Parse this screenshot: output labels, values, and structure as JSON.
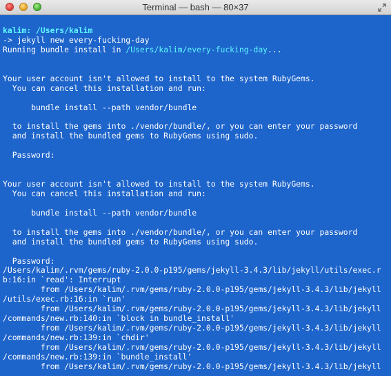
{
  "window": {
    "title": "Terminal — bash — 80×37"
  },
  "prompt": {
    "user": "kalim:",
    "path": "/Users/kalim"
  },
  "lines": [
    {
      "type": "cmd",
      "text": "-> jekyll new every-fucking-day"
    },
    {
      "type": "running",
      "prefix": "Running bundle install in ",
      "path": "/Users/kalim/every-fucking-day",
      "suffix": "..."
    },
    {
      "type": "blank",
      "text": ""
    },
    {
      "type": "blank",
      "text": ""
    },
    {
      "type": "text",
      "text": "Your user account isn't allowed to install to the system RubyGems."
    },
    {
      "type": "text",
      "text": "  You can cancel this installation and run:"
    },
    {
      "type": "blank",
      "text": ""
    },
    {
      "type": "text",
      "text": "      bundle install --path vendor/bundle"
    },
    {
      "type": "blank",
      "text": ""
    },
    {
      "type": "text",
      "text": "  to install the gems into ./vendor/bundle/, or you can enter your password"
    },
    {
      "type": "text",
      "text": "  and install the bundled gems to RubyGems using sudo."
    },
    {
      "type": "blank",
      "text": ""
    },
    {
      "type": "text",
      "text": "  Password:"
    },
    {
      "type": "blank",
      "text": ""
    },
    {
      "type": "blank",
      "text": ""
    },
    {
      "type": "text",
      "text": "Your user account isn't allowed to install to the system RubyGems."
    },
    {
      "type": "text",
      "text": "  You can cancel this installation and run:"
    },
    {
      "type": "blank",
      "text": ""
    },
    {
      "type": "text",
      "text": "      bundle install --path vendor/bundle"
    },
    {
      "type": "blank",
      "text": ""
    },
    {
      "type": "text",
      "text": "  to install the gems into ./vendor/bundle/, or you can enter your password"
    },
    {
      "type": "text",
      "text": "  and install the bundled gems to RubyGems using sudo."
    },
    {
      "type": "blank",
      "text": ""
    },
    {
      "type": "text",
      "text": "  Password:"
    },
    {
      "type": "text",
      "text": "/Users/kalim/.rvm/gems/ruby-2.0.0-p195/gems/jekyll-3.4.3/lib/jekyll/utils/exec.r"
    },
    {
      "type": "text",
      "text": "b:16:in `read': Interrupt"
    },
    {
      "type": "text",
      "text": "        from /Users/kalim/.rvm/gems/ruby-2.0.0-p195/gems/jekyll-3.4.3/lib/jekyll"
    },
    {
      "type": "text",
      "text": "/utils/exec.rb:16:in `run'"
    },
    {
      "type": "text",
      "text": "        from /Users/kalim/.rvm/gems/ruby-2.0.0-p195/gems/jekyll-3.4.3/lib/jekyll"
    },
    {
      "type": "text",
      "text": "/commands/new.rb:140:in `block in bundle_install'"
    },
    {
      "type": "text",
      "text": "        from /Users/kalim/.rvm/gems/ruby-2.0.0-p195/gems/jekyll-3.4.3/lib/jekyll"
    },
    {
      "type": "text",
      "text": "/commands/new.rb:139:in `chdir'"
    },
    {
      "type": "text",
      "text": "        from /Users/kalim/.rvm/gems/ruby-2.0.0-p195/gems/jekyll-3.4.3/lib/jekyll"
    },
    {
      "type": "text",
      "text": "/commands/new.rb:139:in `bundle_install'"
    },
    {
      "type": "text",
      "text": "        from /Users/kalim/.rvm/gems/ruby-2.0.0-p195/gems/jekyll-3.4.3/lib/jekyll"
    }
  ],
  "colors": {
    "background": "#1d64cb",
    "foreground": "#ffffff",
    "prompt": "#5ff7ff"
  },
  "icons": {
    "close": "close-button-icon",
    "minimize": "minimize-button-icon",
    "zoom": "zoom-button-icon",
    "fullscreen": "fullscreen-icon"
  }
}
